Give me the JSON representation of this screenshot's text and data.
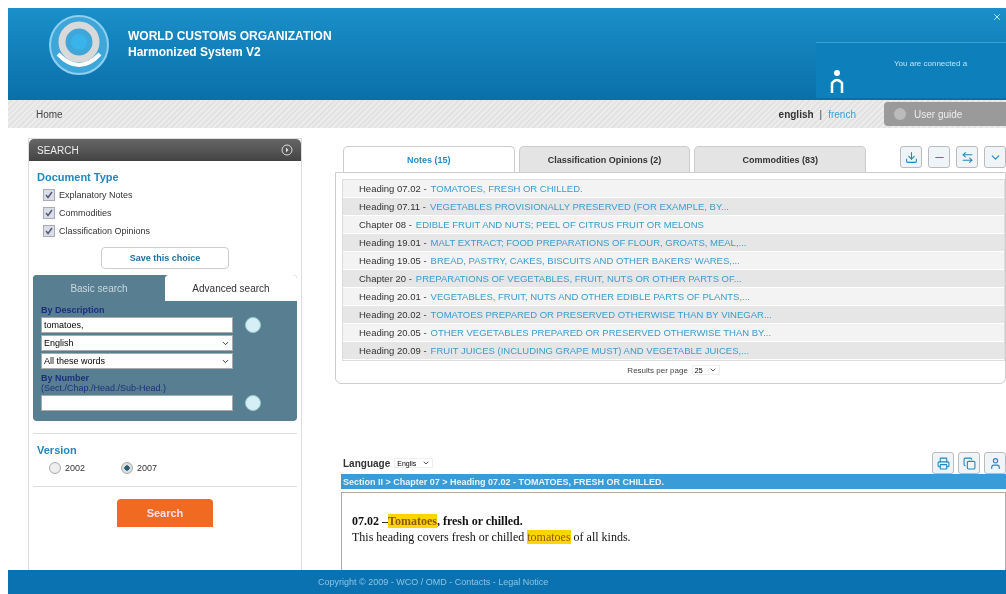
{
  "header": {
    "org_name": "WORLD CUSTOMS ORGANIZATION",
    "system_name": "Harmonized System V2",
    "connection_text": "You are connected a"
  },
  "nav": {
    "home": "Home",
    "languages": [
      {
        "label": "english",
        "selected": true
      },
      {
        "label": "french",
        "selected": false
      }
    ],
    "separator": "|",
    "user_guide": "User guide"
  },
  "search_panel": {
    "title": "SEARCH",
    "document_type": {
      "title": "Document Type",
      "options": [
        {
          "label": "Explanatory Notes",
          "checked": true
        },
        {
          "label": "Commodities",
          "checked": true
        },
        {
          "label": "Classification Opinions",
          "checked": true
        }
      ]
    },
    "save_button": "Save this choice",
    "tabs": [
      {
        "label": "Basic search",
        "selected": true
      },
      {
        "label": "Advanced search",
        "selected": false
      }
    ],
    "description_label": "By Description",
    "description_value": "tomatoes,",
    "language_select": "English",
    "words_select": "All these words",
    "number_label": "By Number",
    "number_hint": "(Sect./Chap./Head./Sub-Head.)",
    "version": {
      "title": "Version",
      "options": [
        {
          "label": "2002",
          "selected": false
        },
        {
          "label": "2007",
          "selected": true
        }
      ]
    },
    "search_button": "Search"
  },
  "results": {
    "tabs": [
      {
        "label": "Notes (15)",
        "selected": true
      },
      {
        "label": "Classification Opinions (2)",
        "selected": false
      },
      {
        "label": "Commodities (83)",
        "selected": false
      }
    ],
    "rows": [
      {
        "prefix": "Heading 07.02 -",
        "title": "TOMATOES, FRESH OR CHILLED."
      },
      {
        "prefix": "Heading 07.11 -",
        "title": "VEGETABLES PROVISIONALLY PRESERVED (FOR EXAMPLE, BY..."
      },
      {
        "prefix": "Chapter 08 -",
        "title": "EDIBLE FRUIT AND NUTS; PEEL OF CITRUS FRUIT OR MELONS"
      },
      {
        "prefix": "Heading 19.01 -",
        "title": "MALT EXTRACT; FOOD PREPARATIONS OF FLOUR, GROATS, MEAL,..."
      },
      {
        "prefix": "Heading 19.05 -",
        "title": "BREAD, PASTRY, CAKES, BISCUITS AND OTHER BAKERS' WARES,..."
      },
      {
        "prefix": "Chapter 20 -",
        "title": "PREPARATIONS OF VEGETABLES, FRUIT, NUTS OR OTHER PARTS OF..."
      },
      {
        "prefix": "Heading 20.01 -",
        "title": "VEGETABLES, FRUIT, NUTS AND OTHER EDIBLE PARTS OF PLANTS,..."
      },
      {
        "prefix": "Heading 20.02 -",
        "title": "TOMATOES PREPARED OR PRESERVED OTHERWISE THAN BY VINEGAR..."
      },
      {
        "prefix": "Heading 20.05 -",
        "title": "OTHER VEGETABLES PREPARED OR PRESERVED OTHERWISE THAN BY..."
      },
      {
        "prefix": "Heading 20.09 -",
        "title": "FRUIT JUICES (INCLUDING GRAPE MUST) AND VEGETABLE JUICES,..."
      }
    ],
    "per_page_label": "Results per page",
    "per_page_value": "25"
  },
  "detail": {
    "language_label": "Language",
    "language_value": "Englis",
    "breadcrumb": "Section II > Chapter 07 > Heading 07.02 - TOMATOES, FRESH OR CHILLED.",
    "heading": [
      {
        "text": "07.02 –",
        "highlighted": false
      },
      {
        "text": "Tomatoes",
        "highlighted": true
      },
      {
        "text": ", fresh or chilled.",
        "highlighted": false
      }
    ],
    "body": [
      {
        "text": "This heading covers fresh or chilled ",
        "highlighted": false
      },
      {
        "text": "tomatoes",
        "highlighted": true
      },
      {
        "text": " of all kinds.",
        "highlighted": false
      }
    ]
  },
  "footer": {
    "copyright": "Copyright © 2009 - WCO / OMD - Contacts - Legal Notice"
  }
}
